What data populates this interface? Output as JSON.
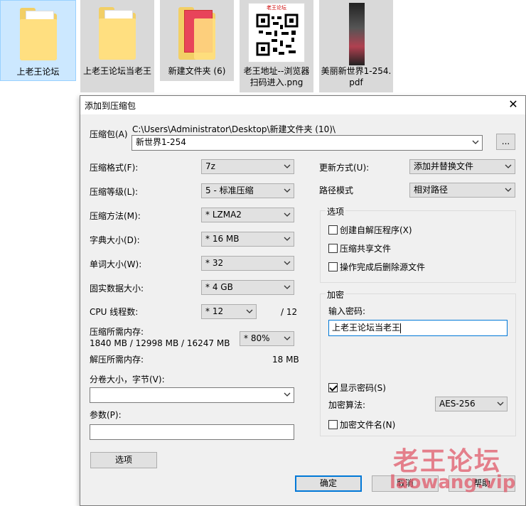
{
  "desktop": {
    "items": [
      {
        "label": "上老王论坛"
      },
      {
        "label": "上老王论坛当老王"
      },
      {
        "label": "新建文件夹 (6)"
      },
      {
        "label": "老王地址--浏览器扫码进入.png",
        "thumb_text": "老王论坛"
      },
      {
        "label": "美丽新世界1-254.pdf"
      }
    ]
  },
  "dialog": {
    "title": "添加到压缩包",
    "archive_label": "压缩包(A)",
    "archive_path": "C:\\Users\\Administrator\\Desktop\\新建文件夹 (10)\\",
    "archive_name": "新世界1-254",
    "browse_label": "...",
    "left": {
      "format": {
        "label": "压缩格式(F):",
        "value": "7z"
      },
      "level": {
        "label": "压缩等级(L):",
        "value": "5 - 标准压缩"
      },
      "method": {
        "label": "压缩方法(M):",
        "value": "* LZMA2"
      },
      "dict": {
        "label": "字典大小(D):",
        "value": "* 16 MB"
      },
      "word": {
        "label": "单词大小(W):",
        "value": "* 32"
      },
      "solid": {
        "label": "固实数据大小:",
        "value": "* 4 GB"
      },
      "cpu": {
        "label": "CPU 线程数:",
        "value": "* 12",
        "total": "/ 12"
      },
      "mem": {
        "label": "压缩所需内存:",
        "detail": "1840 MB / 12998 MB / 16247 MB",
        "value": "* 80%"
      },
      "decomp": {
        "label": "解压所需内存:",
        "value": "18 MB"
      },
      "volume": {
        "label": "分卷大小，字节(V):",
        "value": ""
      },
      "params": {
        "label": "参数(P):",
        "value": ""
      },
      "options_button": "选项"
    },
    "right": {
      "update": {
        "label": "更新方式(U):",
        "value": "添加并替换文件"
      },
      "path": {
        "label": "路径模式",
        "value": "相对路径"
      },
      "options_group": "选项",
      "sfx": "创建自解压程序(X)",
      "shared": "压缩共享文件",
      "delete": "操作完成后删除源文件",
      "encrypt_group": "加密",
      "password_label": "输入密码:",
      "password_value": "上老王论坛当老王",
      "show_password": "显示密码(S)",
      "algo_label": "加密算法:",
      "algo_value": "AES-256",
      "encrypt_names": "加密文件名(N)"
    },
    "buttons": {
      "ok": "确定",
      "cancel": "取消",
      "help": "帮助"
    }
  },
  "watermark": {
    "title": "老王论坛",
    "url": "laowang.vip"
  }
}
